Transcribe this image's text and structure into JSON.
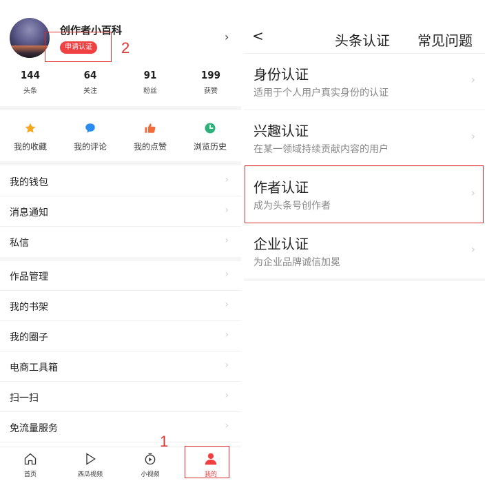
{
  "left": {
    "profile": {
      "username": "创作者小百科",
      "apply_badge": "申请认证"
    },
    "annotations": {
      "badge_number": "2",
      "tab_number": "1"
    },
    "stats": [
      {
        "value": "144",
        "label": "头条"
      },
      {
        "value": "64",
        "label": "关注"
      },
      {
        "value": "91",
        "label": "粉丝"
      },
      {
        "value": "199",
        "label": "获赞"
      }
    ],
    "quick": [
      {
        "label": "我的收藏",
        "icon": "star-icon",
        "color": "#f5a623"
      },
      {
        "label": "我的评论",
        "icon": "comment-icon",
        "color": "#2b8cf0"
      },
      {
        "label": "我的点赞",
        "icon": "thumbs-up-icon",
        "color": "#f26b3a"
      },
      {
        "label": "浏览历史",
        "icon": "clock-icon",
        "color": "#2fb07a"
      }
    ],
    "menu_group1": [
      "我的钱包",
      "消息通知",
      "私信"
    ],
    "menu_group2": [
      "作品管理",
      "我的书架",
      "我的圈子",
      "电商工具箱",
      "扫一扫",
      "免流量服务"
    ],
    "tabs": [
      {
        "label": "首页",
        "icon": "home-icon"
      },
      {
        "label": "西瓜视频",
        "icon": "play-icon"
      },
      {
        "label": "小视频",
        "icon": "short-video-icon"
      },
      {
        "label": "我的",
        "icon": "user-icon"
      }
    ],
    "accent": "#f04142"
  },
  "right": {
    "header": {
      "back": "<",
      "title": "头条认证",
      "faq": "常见问题"
    },
    "certs": [
      {
        "title": "身份认证",
        "subtitle": "适用于个人用户真实身份的认证"
      },
      {
        "title": "兴趣认证",
        "subtitle": "在某一领域持续贡献内容的用户"
      },
      {
        "title": "作者认证",
        "subtitle": "成为头条号创作者"
      },
      {
        "title": "企业认证",
        "subtitle": "为企业品牌诚信加冕"
      }
    ]
  }
}
